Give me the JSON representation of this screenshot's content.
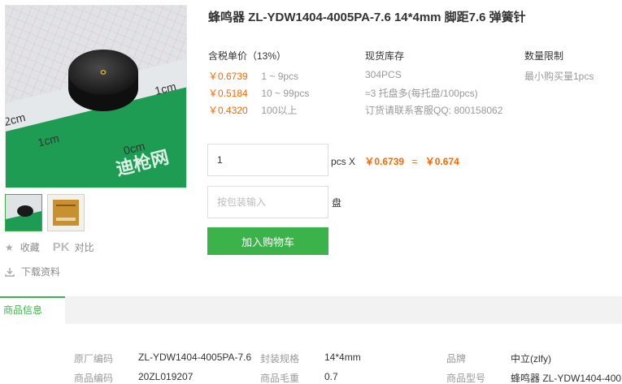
{
  "product": {
    "title": "蜂鸣器 ZL-YDW1404-4005PA-7.6 14*4mm 脚距7.6 弹簧针"
  },
  "gallery": {
    "main_image_name": "buzzer-product-photo",
    "ruler_labels": [
      "2cm",
      "1cm",
      "1cm",
      "0cm",
      "2cm"
    ],
    "watermark": "迪枪网"
  },
  "actions": {
    "favorite_label": "收藏",
    "pk_label": "PK",
    "compare_label": "对比",
    "download_label": "下载资料"
  },
  "pricing": {
    "header": "含税单价（13%）",
    "tiers": [
      {
        "price": "￥0.6739",
        "qty": "1 ~ 9pcs"
      },
      {
        "price": "￥0.5184",
        "qty": "10 ~ 99pcs"
      },
      {
        "price": "￥0.4320",
        "qty": "100以上"
      }
    ]
  },
  "stock": {
    "header": "现货库存",
    "amount": "304PCS",
    "packaging": "≈3 托盘多(每托盘/100pcs)",
    "contact": "订货请联系客服QQ: 800158062"
  },
  "limit": {
    "header": "数量限制",
    "min_order": "最小购买量1pcs"
  },
  "order": {
    "quantity": "1",
    "unit_label": "pcs X",
    "unit_price": "￥0.6739",
    "equals": "=",
    "total": "￥0.674",
    "pack_placeholder": "按包装输入",
    "pack_unit": "盘",
    "add_to_cart": "加入购物车"
  },
  "tabs": {
    "active": "商品信息"
  },
  "specs": [
    {
      "label": "原厂编码",
      "value": "ZL-YDW1404-4005PA-7.6"
    },
    {
      "label": "封装规格",
      "value": "14*4mm"
    },
    {
      "label": "品牌",
      "value": "中立(zlfy)"
    },
    {
      "label": "商品编码",
      "value": "20ZL019207"
    },
    {
      "label": "商品毛重",
      "value": "0.7"
    },
    {
      "label": "商品型号",
      "value": "蜂鸣器 ZL-YDW1404-400"
    }
  ],
  "colors": {
    "accent_green": "#3cb34a",
    "price_orange": "#ff6600"
  }
}
